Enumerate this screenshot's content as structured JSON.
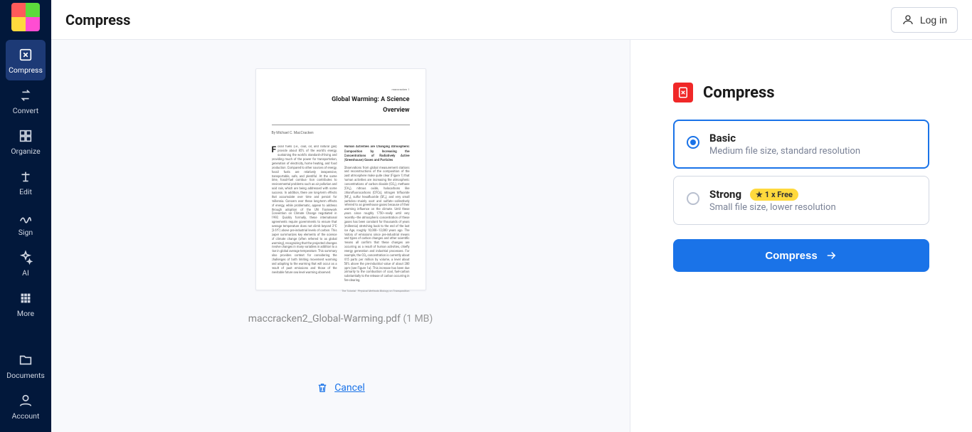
{
  "header": {
    "title": "Compress",
    "login_label": "Log in"
  },
  "sidebar": {
    "items": [
      {
        "label": "Compress",
        "active": true
      },
      {
        "label": "Convert",
        "active": false
      },
      {
        "label": "Organize",
        "active": false
      },
      {
        "label": "Edit",
        "active": false
      },
      {
        "label": "Sign",
        "active": false
      },
      {
        "label": "AI",
        "active": false
      },
      {
        "label": "More",
        "active": false
      }
    ],
    "bottom_items": [
      {
        "label": "Documents"
      },
      {
        "label": "Account"
      }
    ]
  },
  "preview": {
    "doc_title": "Global Warming: A Science",
    "doc_subtitle": "Overview",
    "doc_author": "By Michael C. MacCracken",
    "file_name": "maccracken2_Global-Warming.pdf",
    "file_size": "(1 MB)",
    "cancel_label": "Cancel"
  },
  "options": {
    "panel_title": "Compress",
    "items": [
      {
        "label": "Basic",
        "desc": "Medium file size, standard resolution",
        "selected": true,
        "badge": null
      },
      {
        "label": "Strong",
        "desc": "Small file size, lower resolution",
        "selected": false,
        "badge": "1 x Free"
      }
    ],
    "action_label": "Compress"
  }
}
